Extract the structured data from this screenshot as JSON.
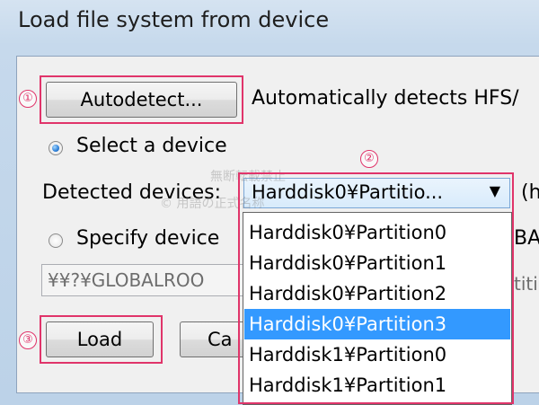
{
  "window": {
    "title": "Load file system from device"
  },
  "autodetect": {
    "button_label": "Autodetect...",
    "description": "Automatically detects HFS/"
  },
  "select_device": {
    "label": "Select a device",
    "checked": true
  },
  "detected_devices": {
    "label": "Detected devices:",
    "selected": "Harddisk0¥Partitio...",
    "trailing_text": "(h"
  },
  "specify_device": {
    "label": "Specify device",
    "trailing_text": "BA",
    "path_value": "¥¥?¥GLOBALROO",
    "path_trailing": "titi",
    "checked": false
  },
  "dropdown": {
    "options": [
      "Harddisk0¥Partition0",
      "Harddisk0¥Partition1",
      "Harddisk0¥Partition2",
      "Harddisk0¥Partition3",
      "Harddisk1¥Partition0",
      "Harddisk1¥Partition1"
    ],
    "selected_index": 3
  },
  "buttons": {
    "load_label": "Load",
    "cancel_label": "Ca"
  },
  "annotations": {
    "marker1": "①",
    "marker2": "②",
    "marker3": "③",
    "highlight_color": "#e0346a"
  },
  "watermark": {
    "line1": "無断転載禁止",
    "line2": "© 用語の正式名称"
  }
}
